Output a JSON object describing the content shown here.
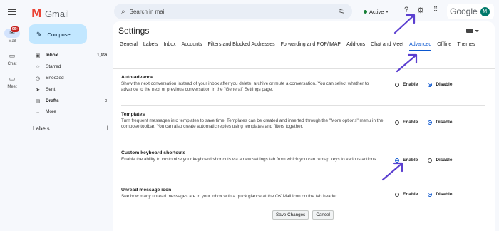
{
  "brand": {
    "name": "Gmail",
    "mark": "M"
  },
  "rail": {
    "badge": "99+",
    "items": [
      {
        "label": "Mail",
        "icon": "mail-icon"
      },
      {
        "label": "Chat",
        "icon": "chat-icon"
      },
      {
        "label": "Meet",
        "icon": "meet-icon"
      }
    ]
  },
  "search": {
    "placeholder": "Search in mail"
  },
  "status": {
    "label": "Active"
  },
  "account": {
    "brand": "Google",
    "avatar": "M"
  },
  "compose": {
    "label": "Compose"
  },
  "nav": [
    {
      "label": "Inbox",
      "count": "1,469",
      "bold": true,
      "icon": "inbox-icon"
    },
    {
      "label": "Starred",
      "count": "",
      "bold": false,
      "icon": "star-icon"
    },
    {
      "label": "Snoozed",
      "count": "",
      "bold": false,
      "icon": "clock-icon"
    },
    {
      "label": "Sent",
      "count": "",
      "bold": false,
      "icon": "send-icon"
    },
    {
      "label": "Drafts",
      "count": "3",
      "bold": true,
      "icon": "draft-icon"
    },
    {
      "label": "More",
      "count": "",
      "bold": false,
      "icon": "chevron-down-icon"
    }
  ],
  "labels": {
    "heading": "Labels"
  },
  "settings": {
    "title": "Settings",
    "tabs": [
      "General",
      "Labels",
      "Inbox",
      "Accounts",
      "Filters and Blocked Addresses",
      "Forwarding and POP/IMAP",
      "Add-ons",
      "Chat and Meet",
      "Advanced",
      "Offline",
      "Themes"
    ],
    "active_tab": "Advanced",
    "sections": [
      {
        "title": "Auto-advance",
        "desc": "Show the next conversation instead of your inbox after you delete, archive or mute a conversation. You can select whether to advance to the next or previous conversation in the \"General\" Settings page.",
        "enable": "Enable",
        "disable": "Disable",
        "selected": "disable"
      },
      {
        "title": "Templates",
        "desc": "Turn frequent messages into templates to save time. Templates can be created and inserted through the \"More options\" menu in the compose toolbar. You can also create automatic replies using templates and filters together.",
        "enable": "Enable",
        "disable": "Disable",
        "selected": "disable"
      },
      {
        "title": "Custom keyboard shortcuts",
        "desc": "Enable the ability to customize your keyboard shortcuts via a new settings tab from which you can remap keys to various actions.",
        "enable": "Enable",
        "disable": "Disable",
        "selected": "enable"
      },
      {
        "title": "Unread message icon",
        "desc": "See how many unread messages are in your inbox with a quick glance at the OK Mail icon on the tab header.",
        "enable": "Enable",
        "disable": "Disable",
        "selected": "disable"
      }
    ],
    "save_label": "Save Changes",
    "cancel_label": "Cancel"
  },
  "colors": {
    "accent": "#0b57d0",
    "compose_bg": "#c2e7ff",
    "arrow": "#5b3fd0",
    "badge": "#c5221f"
  }
}
